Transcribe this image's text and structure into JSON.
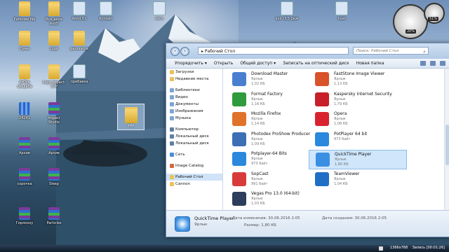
{
  "desktop": {
    "icons": [
      {
        "label": "Рабочие file",
        "kind": "folder"
      },
      {
        "label": "Все дела изо5",
        "kind": "folder"
      },
      {
        "label": "Word Ex",
        "kind": "app"
      },
      {
        "label": "Kontakt",
        "kind": "app"
      },
      {
        "label": "Сумы",
        "kind": "folder"
      },
      {
        "label": "Logo",
        "kind": "folder"
      },
      {
        "label": "panorama",
        "kind": "folder"
      },
      {
        "label": "AHTon свадьба",
        "kind": "folder"
      },
      {
        "label": "Lego Impact-SVP",
        "kind": "folder"
      },
      {
        "label": "прибавка",
        "kind": "app"
      },
      {
        "label": "24281",
        "kind": "grid"
      },
      {
        "label": "Impact Studio",
        "kind": "rar"
      },
      {
        "label": "Архив",
        "kind": "rar"
      },
      {
        "label": "Архив",
        "kind": "rar"
      },
      {
        "label": "сорочка",
        "kind": "rar"
      },
      {
        "label": "Sleep",
        "kind": "rar"
      },
      {
        "label": "Горлохоу",
        "kind": "rar"
      },
      {
        "label": "Particles",
        "kind": "rar"
      },
      {
        "label": "лого",
        "kind": "app"
      },
      {
        "label": "xxx r3.5 реж",
        "kind": "app"
      },
      {
        "label": "host",
        "kind": "app"
      }
    ],
    "dragged_item": {
      "label": "уду"
    }
  },
  "gadget": {
    "cpu": "20%",
    "mem": "51%"
  },
  "window": {
    "address": "Рабочий Стол",
    "search_placeholder": "Поиск: Рабочий Стол",
    "toolbar": [
      "Упорядочить ▾",
      "Открыть",
      "Общий доступ ▾",
      "Записать на оптический диск",
      "Новая папка"
    ],
    "nav_pane": [
      {
        "label": "Загрузки",
        "kind": "fold"
      },
      {
        "label": "Недавние места",
        "kind": "fold"
      },
      {
        "label": "",
        "kind": "gap"
      },
      {
        "label": "Библиотеки",
        "kind": "lib"
      },
      {
        "label": "Видео",
        "kind": "lib"
      },
      {
        "label": "Документы",
        "kind": "lib"
      },
      {
        "label": "Изображения",
        "kind": "lib"
      },
      {
        "label": "Музыка",
        "kind": "lib"
      },
      {
        "label": "",
        "kind": "gap"
      },
      {
        "label": "Компьютер",
        "kind": "pc"
      },
      {
        "label": "Локальный диск",
        "kind": "pc"
      },
      {
        "label": "Локальный диск",
        "kind": "pc"
      },
      {
        "label": "",
        "kind": "gap"
      },
      {
        "label": "Сеть",
        "kind": "net"
      },
      {
        "label": "",
        "kind": "gap"
      },
      {
        "label": "Image Catalog",
        "kind": "img"
      },
      {
        "label": "",
        "kind": "gap"
      },
      {
        "label": "Рабочий Стол",
        "kind": "fold",
        "selected": true
      },
      {
        "label": "Cannon",
        "kind": "fold"
      }
    ],
    "files_left": [
      {
        "name": "Download Master",
        "type": "Ярлык",
        "size": "1,02 КБ",
        "color": "#4a7fd0"
      },
      {
        "name": "Format Factory",
        "type": "Ярлык",
        "size": "1,16 КБ",
        "color": "#2f9b3c"
      },
      {
        "name": "Mozilla Firefox",
        "type": "Ярлык",
        "size": "1,14 КБ",
        "color": "#e0722a"
      },
      {
        "name": "Photodex ProShow Producer",
        "type": "Ярлык",
        "size": "1,09 КБ",
        "color": "#3d6fb5"
      },
      {
        "name": "Potplayer-64 Bits",
        "type": "Ярлык",
        "size": "973 байт",
        "color": "#2a88dd"
      },
      {
        "name": "SopCast",
        "type": "Ярлык",
        "size": "991 байт",
        "color": "#d93b3b"
      },
      {
        "name": "Vegas Pro 13.0 (64-bit)",
        "type": "Ярлык",
        "size": "1,03 КБ",
        "color": "#2d3d5c"
      }
    ],
    "files_right": [
      {
        "name": "FastStone Image Viewer",
        "type": "Ярлык",
        "size": "1,13 КБ",
        "color": "#d9522a"
      },
      {
        "name": "Kaspersky Internet Security",
        "type": "Ярлык",
        "size": "1,79 КБ",
        "color": "#c81f2a"
      },
      {
        "name": "Opera",
        "type": "Ярлык",
        "size": "1,08 КБ",
        "color": "#d8232f"
      },
      {
        "name": "PotPlayer 64 bit",
        "type": "973 байт",
        "size": "",
        "color": "#2a88dd"
      },
      {
        "name": "QuickTime Player",
        "type": "Ярлык",
        "size": "1,80 КБ",
        "color": "#3a8fe2",
        "selected": true
      },
      {
        "name": "TeamViewer",
        "type": "Ярлык",
        "size": "1,04 КБ",
        "color": "#1f6fc6"
      }
    ],
    "details": {
      "name": "QuickTime Player",
      "type": "Ярлык",
      "modified": "Дата изменения: 30.06.2016 2:05",
      "created": "Дата создания: 30.06.2016 2:05",
      "size": "Размер: 1,80 КБ"
    }
  },
  "taskbar": {
    "resolution": "1366x768",
    "recording": "Запись [00:01:26]"
  }
}
